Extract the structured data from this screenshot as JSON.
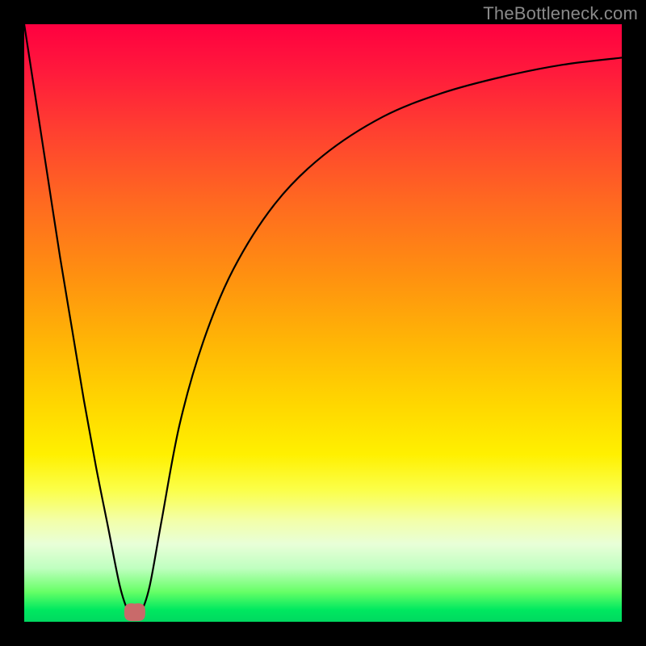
{
  "watermark": "TheBottleneck.com",
  "chart_data": {
    "type": "line",
    "title": "",
    "xlabel": "",
    "ylabel": "",
    "legend": false,
    "grid": false,
    "x_range": [
      0,
      100
    ],
    "y_range": [
      0,
      100
    ],
    "series": [
      {
        "name": "bottleneck-curve",
        "x_norm": [
          0.0,
          0.02,
          0.04,
          0.06,
          0.08,
          0.1,
          0.12,
          0.14,
          0.16,
          0.175,
          0.185,
          0.195,
          0.21,
          0.23,
          0.26,
          0.3,
          0.35,
          0.42,
          0.5,
          0.6,
          0.7,
          0.8,
          0.9,
          1.0
        ],
        "y_norm": [
          1.0,
          0.87,
          0.74,
          0.61,
          0.49,
          0.37,
          0.26,
          0.16,
          0.06,
          0.015,
          0.008,
          0.015,
          0.06,
          0.17,
          0.33,
          0.47,
          0.59,
          0.7,
          0.78,
          0.845,
          0.885,
          0.912,
          0.932,
          0.944
        ]
      }
    ],
    "marker": {
      "name": "minimum-marker",
      "x_norm": 0.185,
      "y_norm": 0.008,
      "color": "#c96a6a"
    },
    "background_gradient": {
      "top": "#ff0040",
      "mid": "#ffe000",
      "bottom": "#00d860"
    }
  }
}
